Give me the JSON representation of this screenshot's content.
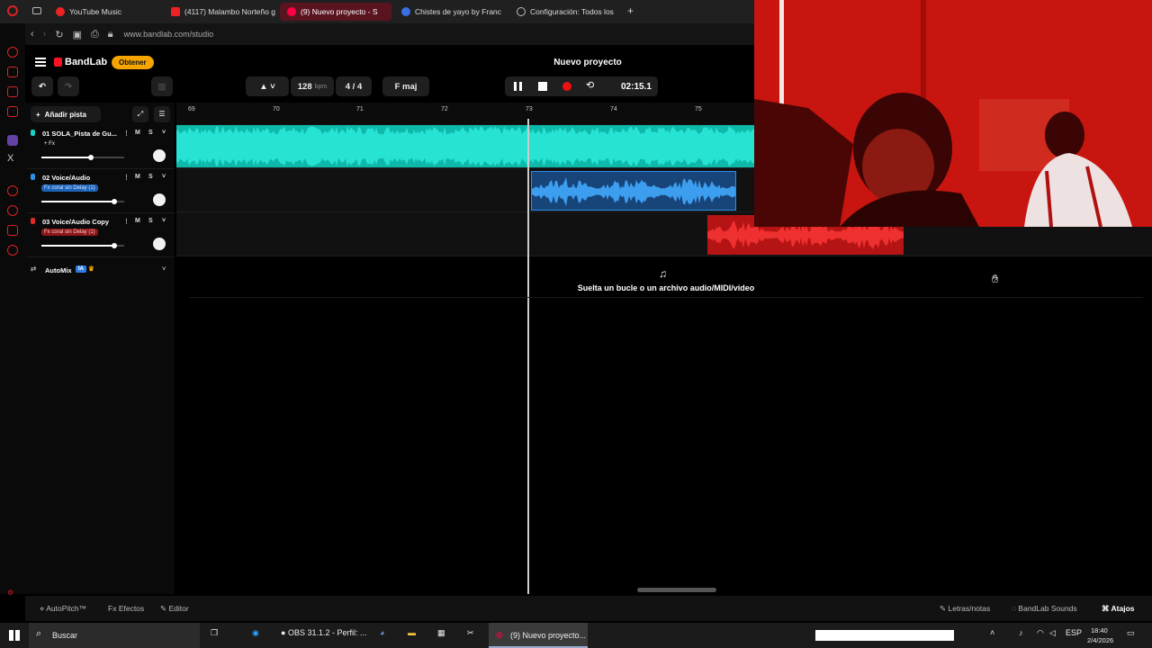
{
  "browser": {
    "tabs": [
      {
        "label": "YouTube Music",
        "icon": "youtube-music-icon"
      },
      {
        "label": "(4117) Malambo Norteño g",
        "icon": "youtube-icon"
      },
      {
        "label": "(9) Nuevo proyecto - S",
        "icon": "bandlab-icon",
        "active": true
      },
      {
        "label": "Chistes de yayo by Franc",
        "icon": "globe-icon"
      },
      {
        "label": "Configuración: Todos los",
        "icon": "settings-icon"
      }
    ],
    "new_tab": "+",
    "url": "www.bandlab.com/studio"
  },
  "app": {
    "logo": "BandLab",
    "get_button": "Obtener",
    "project_title": "Nuevo proyecto",
    "bpm_value": "128",
    "bpm_unit": "bpm",
    "time_signature": "4 / 4",
    "key": "F maj",
    "time": "02:15.1",
    "add_track": "Añadir pista",
    "automix": "AutoMix",
    "automix_badge": "IA",
    "drop_text": "Suelta un bucle o un archivo audio/MIDI/video"
  },
  "ruler": [
    "69",
    "70",
    "71",
    "72",
    "73",
    "74",
    "75"
  ],
  "tracks": [
    {
      "name": "01  SOLA_Pista de Gu...",
      "fx": "+ Fx",
      "color": "#16d3c4",
      "mute": "M",
      "solo": "S",
      "volume": 0.6
    },
    {
      "name": "02  Voice/Audio",
      "fx": "Fx  coral sin Delay (1)",
      "color": "#2f8fe6",
      "mute": "M",
      "solo": "S",
      "volume": 0.88
    },
    {
      "name": "03  Voice/Audio Copy",
      "fx": "Fx  coral sin Delay (1)",
      "color": "#e02a2a",
      "mute": "M",
      "solo": "S",
      "volume": 0.88
    }
  ],
  "bottom": {
    "autopitch": "AutoPitch™",
    "effects": "Efectos",
    "editor": "Editor",
    "lyrics": "Letras/notas",
    "sounds": "BandLab Sounds",
    "shortcuts": "Atajos"
  },
  "taskbar": {
    "search": "Buscar",
    "obs": "OBS 31.1.2 - Perfil: ...",
    "browser_task": "(9) Nuevo proyecto...",
    "lang": "ESP",
    "time": "18:40",
    "date": "2/4/2026"
  }
}
